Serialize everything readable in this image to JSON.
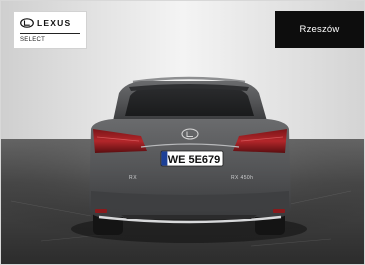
{
  "brand": {
    "name": "LEXUS",
    "program": "SELECT"
  },
  "location": {
    "label": "Rzeszów"
  },
  "vehicle": {
    "plate": "WE 5E679",
    "badge_left": "RX",
    "badge_right": "RX 450h"
  },
  "colors": {
    "button_bg": "#0d0d0d",
    "car_body": "#565759",
    "floor": "#3a3a3a"
  }
}
